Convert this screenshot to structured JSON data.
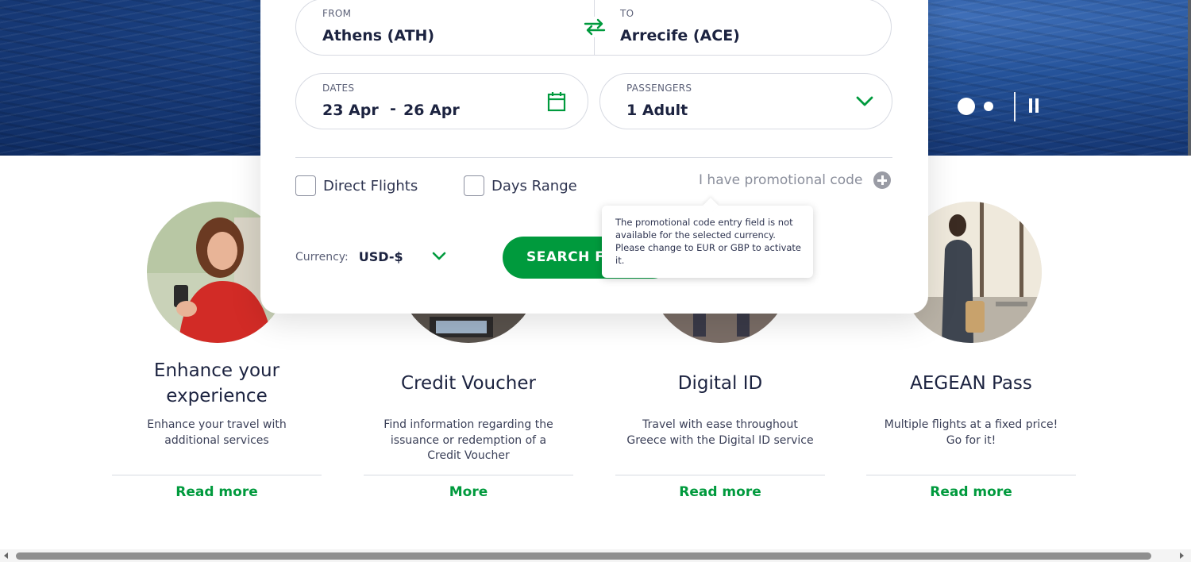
{
  "search": {
    "from_label": "FROM",
    "from_value": "Athens (ATH)",
    "to_label": "TO",
    "to_value": "Arrecife (ACE)",
    "dates_label": "DATES",
    "date_out": "23 Apr",
    "date_sep": "-",
    "date_back": "26 Apr",
    "passengers_label": "PASSENGERS",
    "passengers_value": "1 Adult",
    "direct_flights": "Direct Flights",
    "days_range": "Days Range",
    "promo_label": "I have promotional code",
    "currency_label": "Currency:",
    "currency_value": "USD-$",
    "search_button": "SEARCH FLIGHTS",
    "tooltip": "The promotional code entry field is not available for the selected currency. Please change to EUR or GBP to activate it."
  },
  "cards": [
    {
      "title": "Enhance your experience",
      "desc": "Enhance your travel with additional services",
      "link": "Read more"
    },
    {
      "title": "Credit Voucher",
      "desc": "Find information regarding the issuance or redemption of a Credit Voucher",
      "link": "More"
    },
    {
      "title": "Digital ID",
      "desc": "Travel with ease throughout Greece with the Digital ID service",
      "link": "Read more"
    },
    {
      "title": "AEGEAN Pass",
      "desc": "Multiple flights at a fixed price! Go for it!",
      "link": "Read more"
    }
  ],
  "colors": {
    "accent": "#009a3d",
    "text": "#1c2340",
    "hero": "#173a78"
  },
  "icons": [
    "swap-icon",
    "calendar-icon",
    "chevron-down-icon",
    "plus-circle-icon",
    "pause-icon"
  ],
  "carousel": {
    "slides": 2,
    "active": 1
  }
}
